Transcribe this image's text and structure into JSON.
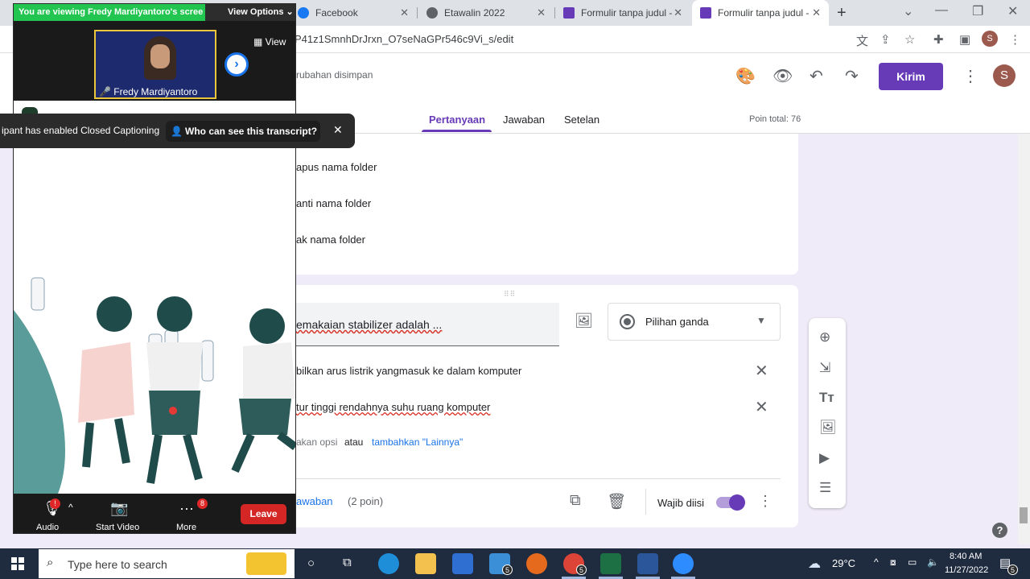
{
  "browser": {
    "tabs": [
      {
        "title": "Facebook"
      },
      {
        "title": "Etawalin 2022"
      },
      {
        "title": "Formulir tanpa judul -"
      },
      {
        "title": "Formulir tanpa judul -"
      }
    ],
    "url": "P41z1SmnhDrJrxn_O7seNaGPr546c9Vi_s/edit"
  },
  "forms": {
    "save_status": "rubahan disimpan",
    "send_label": "Kirim",
    "avatar_letter": "S",
    "tabs": [
      "Pertanyaan",
      "Jawaban",
      "Setelan"
    ],
    "total_points": "Poin total: 76",
    "prev_options": [
      "apus nama folder",
      "anti nama folder",
      "ak nama folder"
    ],
    "question": "emakaian stabilizer adalah ...",
    "question_type": "Pilihan ganda",
    "answers": [
      "bilkan arus listrik yangmasuk ke dalam komputer",
      "tur tinggi rendahnya suhu ruang komputer"
    ],
    "add_option": "akan opsi",
    "or_label": "atau",
    "add_other": "tambahkan \"Lainnya\"",
    "answer_key": "awaban",
    "points": "(2 poin)",
    "required_label": "Wajib diisi"
  },
  "zoom": {
    "viewing_banner": "You are viewing Fredy Mardiyantoro's scree",
    "view_options": "View Options",
    "view_button": "View",
    "participant_name": "Fredy Mardiyantoro",
    "caption_text": "ipant has enabled Closed Captioning",
    "transcript_button": "Who can see this transcript?",
    "toolbar": {
      "audio": "Audio",
      "start_video": "Start Video",
      "more": "More",
      "more_badge": "8",
      "leave": "Leave"
    }
  },
  "taskbar": {
    "search_placeholder": "Type here to search",
    "temperature": "29°C",
    "time": "8:40 AM",
    "date": "11/27/2022",
    "mail_badge": "5",
    "chrome_badge": "5",
    "notif_badge": "5"
  },
  "colors": {
    "accent": "#673ab7",
    "zoom_green": "#23c551",
    "zoom_red": "#d52626",
    "link_blue": "#1a73e8"
  }
}
